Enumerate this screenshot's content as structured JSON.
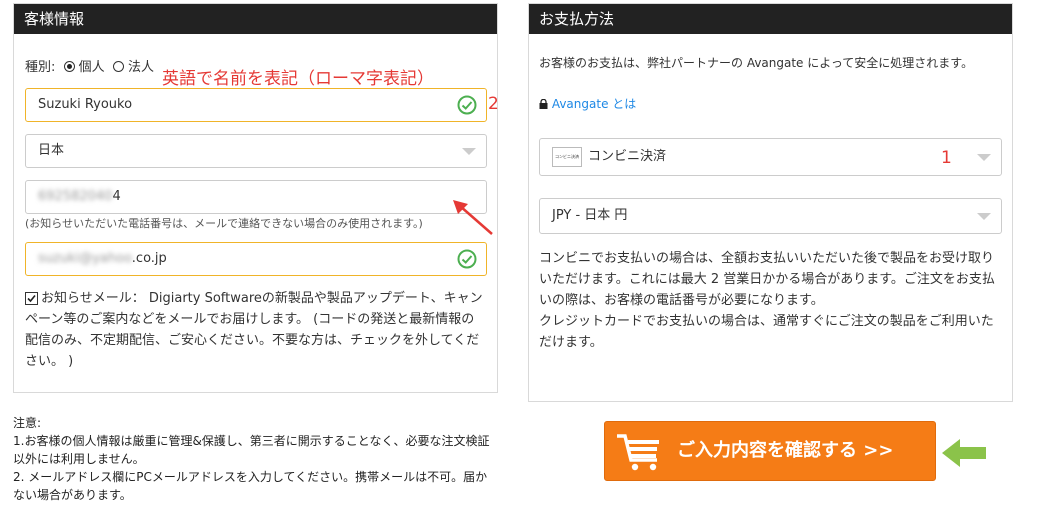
{
  "customer": {
    "title": "客様情報",
    "type_label": "種別:",
    "type_options": [
      "個人",
      "法人"
    ],
    "annotation": "英語で名前を表記（ローマ字表記）",
    "annotation_number": "2",
    "name_value": "Suzuki Ryouko",
    "country_value": "日本",
    "phone_value_hidden": "692582040",
    "phone_value_tail": "4",
    "phone_note": "(お知らせいただいた電話番号は、メールで連絡できない場合のみ使用されます。)",
    "email_value_hidden": "suzuki@yahoo",
    "email_value_tail": ".co.jp",
    "newsletter_text": "お知らせメール： Digiarty Softwareの新製品や製品アップデート、キャンペーン等のご案内などをメールでお届けします。 (コードの発送と最新情報の配信のみ、不定期配信、ご安心ください。不要な方は、チェックを外してください。 )"
  },
  "notes": {
    "title": "注意:",
    "line1": "1.お客様の個人情報は厳重に管理&保護し、第三者に開示することなく、必要な注文検証以外には利用しません。",
    "line2": "2. メールアドレス欄にPCメールアドレスを入力してください。携帯メールは不可。届かない場合があります。"
  },
  "payment": {
    "title": "お支払方法",
    "intro": "お客様のお支払は、弊社パートナーの Avangate によって安全に処理されます。",
    "avangate_link": "Avangate とは",
    "method_logo": "コンビニ決済",
    "method_value": "コンビニ決済",
    "method_annotation": "1",
    "currency_value": "JPY - 日本 円",
    "description": "コンビニでお支払いの場合は、全額お支払いいただいた後で製品をお受け取りいただけます。これには最大 2 営業日かかる場合があります。ご注文をお支払いの際は、お客様の電話番号が必要になります。\nクレジットカードでお支払いの場合は、通常すぐにご注文の製品をご利用いただけます。"
  },
  "confirm_button": {
    "label": "ご入力内容を確認する >>"
  },
  "colors": {
    "accent_orange": "#f57c16",
    "valid_green": "#4caf50",
    "annotation_red": "#e53935",
    "arrow_green": "#8bc34a"
  }
}
